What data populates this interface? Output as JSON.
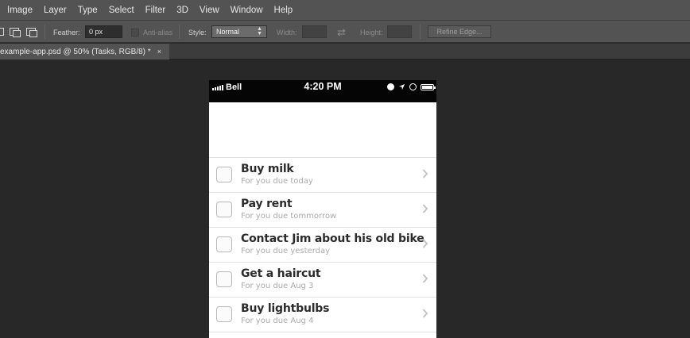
{
  "menu": [
    "Image",
    "Layer",
    "Type",
    "Select",
    "Filter",
    "3D",
    "View",
    "Window",
    "Help"
  ],
  "options": {
    "feather_label": "Feather:",
    "feather_value": "0 px",
    "antialias_label": "Anti-alias",
    "style_label": "Style:",
    "style_value": "Normal",
    "width_label": "Width:",
    "height_label": "Height:",
    "refine_edge": "Refine Edge..."
  },
  "document_tab": {
    "label": "example-app.psd @ 50% (Tasks, RGB/8) *",
    "close": "×"
  },
  "phone": {
    "carrier": "Bell",
    "time": "4:20 PM",
    "tasks": [
      {
        "title": "Buy milk",
        "subtitle": "For you due today"
      },
      {
        "title": "Pay rent",
        "subtitle": "For you due tommorrow"
      },
      {
        "title": "Contact Jim about his old bike",
        "subtitle": "For you due yesterday"
      },
      {
        "title": "Get a haircut",
        "subtitle": "For you due Aug 3"
      },
      {
        "title": "Buy lightbulbs",
        "subtitle": "For you due Aug 4"
      }
    ]
  },
  "colors": {
    "ui_panel": "#535353",
    "canvas": "#282828",
    "status_bar": "#050505",
    "task_title": "#2b2b2b",
    "task_subtitle": "#aaaaaa"
  }
}
